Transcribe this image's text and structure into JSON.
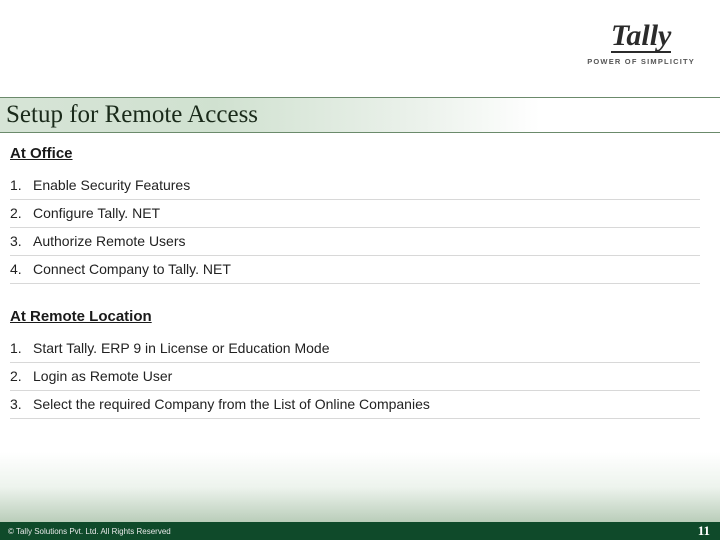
{
  "logo": {
    "name": "Tally",
    "tagline": "POWER OF SIMPLICITY"
  },
  "title": "Setup for Remote Access",
  "sections": [
    {
      "heading": "At Office",
      "items": [
        "Enable Security Features",
        "Configure Tally. NET",
        "Authorize Remote Users",
        "Connect Company to Tally. NET"
      ]
    },
    {
      "heading": "At Remote Location",
      "items": [
        "Start Tally. ERP 9 in License or Education Mode",
        "Login as Remote User",
        "Select the required Company from the List of Online Companies"
      ]
    }
  ],
  "footer": {
    "copyright": "© Tally Solutions Pvt. Ltd. All Rights Reserved",
    "page": "11"
  }
}
